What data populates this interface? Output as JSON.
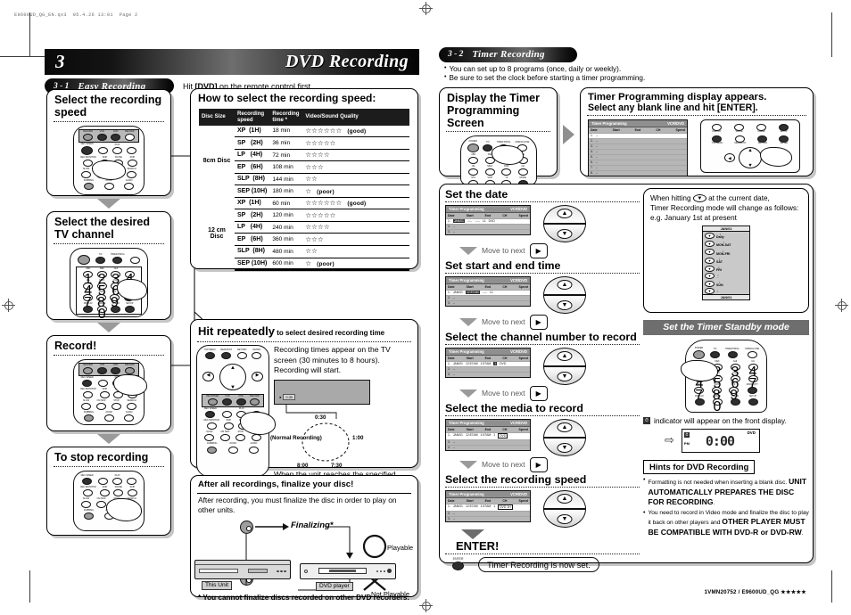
{
  "print_marks": {
    "header": "E9600UD_QG_EN.qx3  05.4.26 13:01  Page 2"
  },
  "chapter": {
    "number": "3",
    "title": "DVD Recording"
  },
  "left": {
    "section": {
      "number": "3 - 1",
      "title": "Easy Recording"
    },
    "lead": {
      "pre": "Hit ",
      "key": "[DVD]",
      "post": " on the remote control first."
    },
    "steps": [
      {
        "title": "Select the recording speed",
        "remote": "rec-speed-remote"
      },
      {
        "title": "Select the desired TV channel",
        "remote": "numeric-keypad-remote"
      },
      {
        "title": "Record!",
        "remote": "record-button-remote"
      },
      {
        "title": "To stop recording",
        "remote": "stop-button-remote"
      }
    ],
    "speed_box": {
      "title": "How to select the recording speed:",
      "headers": [
        "Disc Size",
        "Recording speed",
        "Recording time *",
        "Video/Sound Quality"
      ],
      "groups": [
        {
          "disc": "8cm Disc",
          "rows": [
            {
              "mode": "XP  (1H)",
              "time": "18 min",
              "stars": "☆☆☆☆☆☆",
              "note": "(good)"
            },
            {
              "mode": "SP   (2H)",
              "time": "36 min",
              "stars": "☆☆☆☆☆",
              "note": ""
            },
            {
              "mode": "LP   (4H)",
              "time": "72 min",
              "stars": "☆☆☆☆",
              "note": ""
            },
            {
              "mode": "EP   (6H)",
              "time": "108 min",
              "stars": "☆☆☆",
              "note": ""
            },
            {
              "mode": "SLP  (8H)",
              "time": "144 min",
              "stars": "☆☆",
              "note": ""
            },
            {
              "mode": "SEP (10H)",
              "time": "180 min",
              "stars": "☆",
              "note": "(poor)"
            }
          ]
        },
        {
          "disc": "12 cm Disc",
          "rows": [
            {
              "mode": "XP  (1H)",
              "time": "60 min",
              "stars": "☆☆☆☆☆☆",
              "note": "(good)"
            },
            {
              "mode": "SP   (2H)",
              "time": "120 min",
              "stars": "☆☆☆☆☆",
              "note": ""
            },
            {
              "mode": "LP   (4H)",
              "time": "240 min",
              "stars": "☆☆☆☆",
              "note": ""
            },
            {
              "mode": "EP   (6H)",
              "time": "360 min",
              "stars": "☆☆☆",
              "note": ""
            },
            {
              "mode": "SLP  (8H)",
              "time": "480 min",
              "stars": "☆☆",
              "note": ""
            },
            {
              "mode": "SEP (10H)",
              "time": "600 min",
              "stars": "☆",
              "note": "(poor)"
            }
          ]
        }
      ]
    },
    "hit_box": {
      "title_bold": "Hit repeatedly",
      "title_rest": " to select desired recording time",
      "body": "Recording times appear on the TV screen (30 minutes to 8 hours). Recording will start.",
      "osd_value": "0:30",
      "dial": {
        "top": "0:30",
        "right": "1:00",
        "bottom_right": "7:30",
        "bottom_left": "8:00",
        "center_label": "(Normal Recording)"
      },
      "footer": "When the unit reaches the specified time, recording will stop automatically."
    },
    "finalize_box": {
      "title": "After all recordings, finalize your disc!",
      "body": "After recording, you must finalize the disc in order to play on other units.",
      "arrow_label": "Finalizing*",
      "tag_unit": "This Unit",
      "tag_player": "DVD player",
      "playable": "Playable",
      "not_playable": "Not Playable",
      "footnote": "* You cannot finalize discs recorded on other DVD recorders."
    }
  },
  "right": {
    "section": {
      "number": "3 - 2",
      "title": "Timer Recording"
    },
    "notes": [
      "You can set up to 8 programs (once, daily or weekly).",
      "Be sure to set the clock before starting a timer programming."
    ],
    "step1": {
      "title_line1": "Display the Timer",
      "title_line2": "Programming Screen"
    },
    "step2": {
      "title": "Timer Programming display appears.",
      "subtitle": "Select any blank line and hit [ENTER]."
    },
    "osd": {
      "title": "Timer Programming",
      "media": "VCR/DVD",
      "columns": [
        "Date",
        "Start",
        "End",
        "CH",
        "Speed"
      ],
      "empty_rows": [
        "1.",
        "2.",
        "3.",
        "4.",
        "5.",
        "6.",
        "7.",
        "8."
      ]
    },
    "steps": [
      {
        "title": "Set the date",
        "row": {
          "n": "1.",
          "date": "JAN/01",
          "start": "--:--",
          "end": "--:--",
          "ch": "L1",
          "speed": "DVD"
        },
        "hl": "date",
        "next": "Move to next"
      },
      {
        "title": "Set start and end time",
        "row": {
          "n": "1.",
          "date": "JAN/01",
          "start": "12:57AM",
          "end": "--:--",
          "ch": "L1",
          "speed": ""
        },
        "hl": "start",
        "next": "Move to next"
      },
      {
        "title": "Select the channel number to record",
        "row": {
          "n": "1.",
          "date": "JAN/01",
          "start": "12:57AM",
          "end": "1:57AM",
          "ch": "1",
          "speed": "DVD"
        },
        "hl": "ch",
        "next": "Move to next"
      },
      {
        "title": "Select the media to record",
        "row": {
          "n": "1.",
          "date": "JAN/01",
          "start": "12:57AM",
          "end": "1:57AM",
          "ch": "1",
          "speed": "DVD"
        },
        "hl": "media",
        "next": "Move to next"
      },
      {
        "title": "Select the recording speed",
        "row": {
          "n": "1.",
          "date": "JAN/01",
          "start": "12:57AM",
          "end": "1:57AM",
          "ch": "1",
          "speed": "DVD  1H"
        },
        "hl": "speed",
        "next": ""
      }
    ],
    "enter": {
      "label": "ENTER!",
      "key": "ENTER",
      "confirm": "Timer Recording is now set."
    },
    "date_note": {
      "line1_pre": "When hitting ",
      "line1_post": " at the current date,",
      "line2": "Timer Recording mode will change as follows:",
      "line3": "e.g. January 1st at present",
      "cap_top": "JAN/01",
      "cap_bottom": "JAN/01",
      "items": [
        "Daily",
        "MON-SAT",
        "MON-FRI",
        "SAT",
        "FRI",
        "",
        "SUN",
        ""
      ]
    },
    "standby": {
      "header": "Set the Timer Standby mode",
      "note": "indicator will appear on the front display.",
      "display_time": "0:00",
      "display_dvd": "DVD",
      "display_pm": "PM"
    },
    "hints": {
      "title": "Hints for DVD Recording",
      "items": [
        {
          "small1": "Formatting is not needed when inserting a blank disc. ",
          "big": "UNIT AUTOMATICALLY PREPARES THE DISC FOR RECORDING",
          "small2": "."
        },
        {
          "small1": "You need to record in Video mode and finalize the disc to play it back on other players and ",
          "big": "OTHER PLAYER MUST BE COMPATIBLE WITH DVD-R or DVD-RW",
          "small2": "."
        }
      ]
    }
  },
  "footer": "1VMN20752 / E9600UD_QG ★★★★★"
}
